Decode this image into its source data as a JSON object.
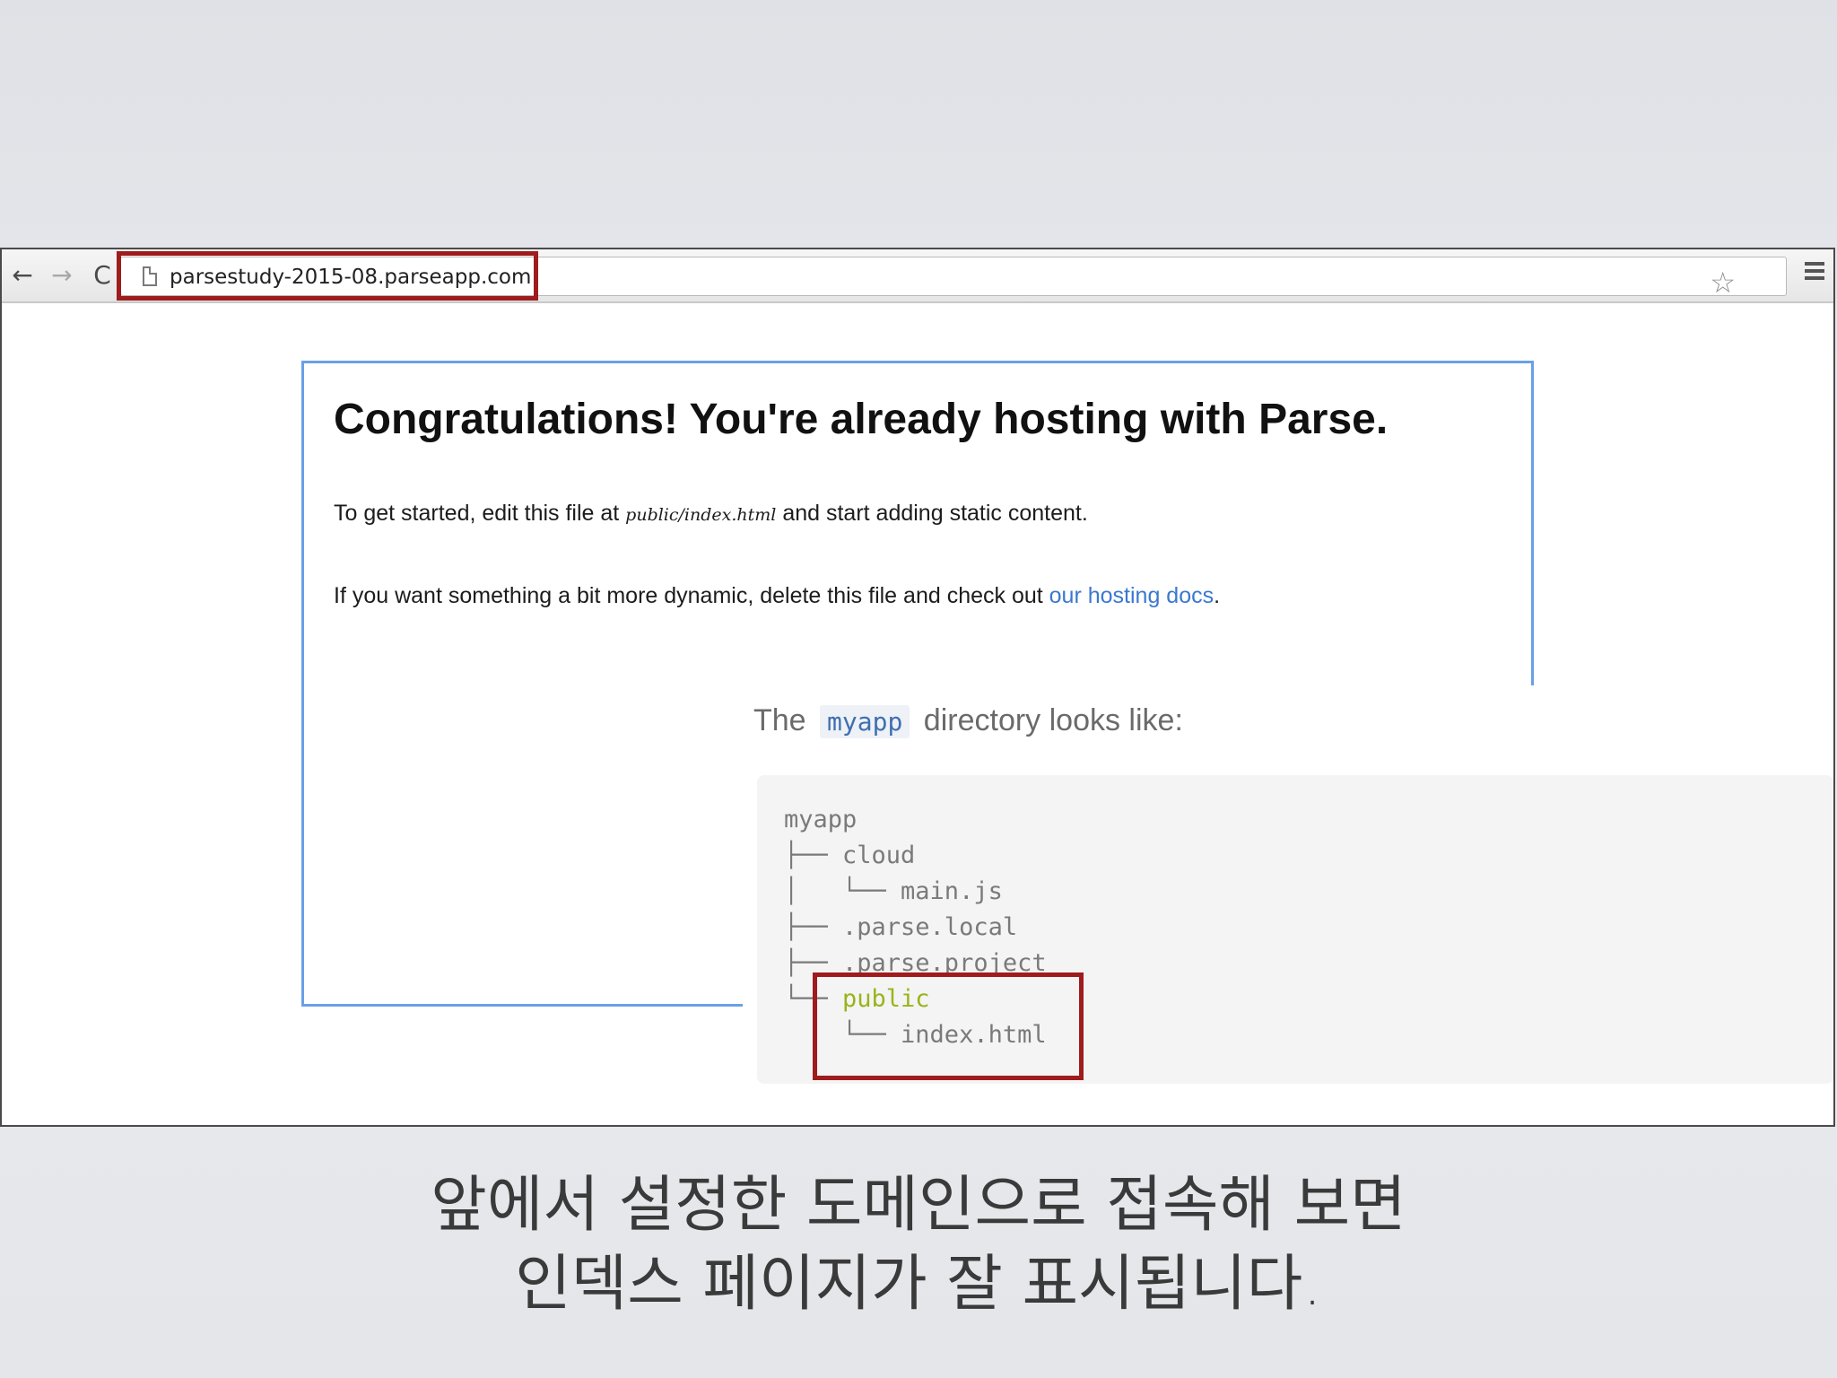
{
  "browser": {
    "url": "parsestudy-2015-08.parseapp.com",
    "back_icon": "←",
    "forward_icon": "→",
    "reload_icon": "C",
    "star_icon": "☆"
  },
  "page": {
    "headline": "Congratulations! You're already hosting with Parse.",
    "para1_before": "To get started, edit this file at ",
    "para1_code": "public/index.html",
    "para1_after": " and start adding static content.",
    "para2_before": "If you want something a bit more dynamic, delete this file and check out ",
    "para2_link": "our hosting docs",
    "para2_after": "."
  },
  "docs": {
    "caption_before": "The",
    "caption_code": "myapp",
    "caption_after": "directory looks like:",
    "tree": [
      "myapp",
      "├── cloud",
      "│   └── main.js",
      "├── .parse.local",
      "├── .parse.project",
      "└── ",
      "    └── index.html"
    ],
    "tree_public": "public"
  },
  "caption": {
    "line1": "앞에서 설정한 도메인으로 접속해 보면",
    "line2": "인덱스 페이지가 잘 표시됩니다."
  },
  "colors": {
    "highlight_red": "#9e1c1c",
    "link_blue": "#3a78d0",
    "box_blue": "#6aa0e6",
    "public_green": "#9ab31a"
  }
}
